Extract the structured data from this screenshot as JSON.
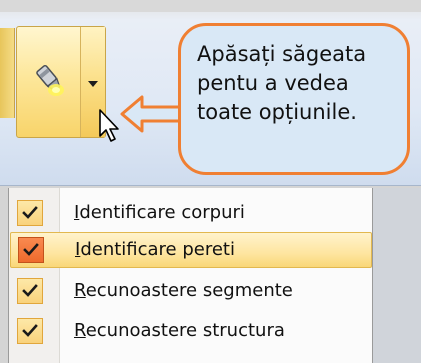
{
  "callout": {
    "text": "Apăsați săgeata\npentu a vedea\ntoate opțiunile."
  },
  "ribbon": {
    "split_button": {
      "icon": "highlighter-icon",
      "arrow_icon": "chevron-down-icon"
    }
  },
  "menu": {
    "items": [
      {
        "mnemonic": "I",
        "rest": "dentificare corpuri",
        "checked": true,
        "highlighted": false
      },
      {
        "mnemonic": "I",
        "rest": "dentificare pereti",
        "checked": true,
        "highlighted": true
      },
      {
        "mnemonic": "R",
        "rest": "ecunoastere segmente",
        "checked": true,
        "highlighted": false
      },
      {
        "mnemonic": "R",
        "rest": "ecunoastere structura",
        "checked": true,
        "highlighted": false
      }
    ]
  },
  "colors": {
    "callout_border": "#f07f32",
    "callout_fill": "#d9e8f6",
    "highlight": "#fee5a0",
    "check_active": "#ee6a2c"
  }
}
